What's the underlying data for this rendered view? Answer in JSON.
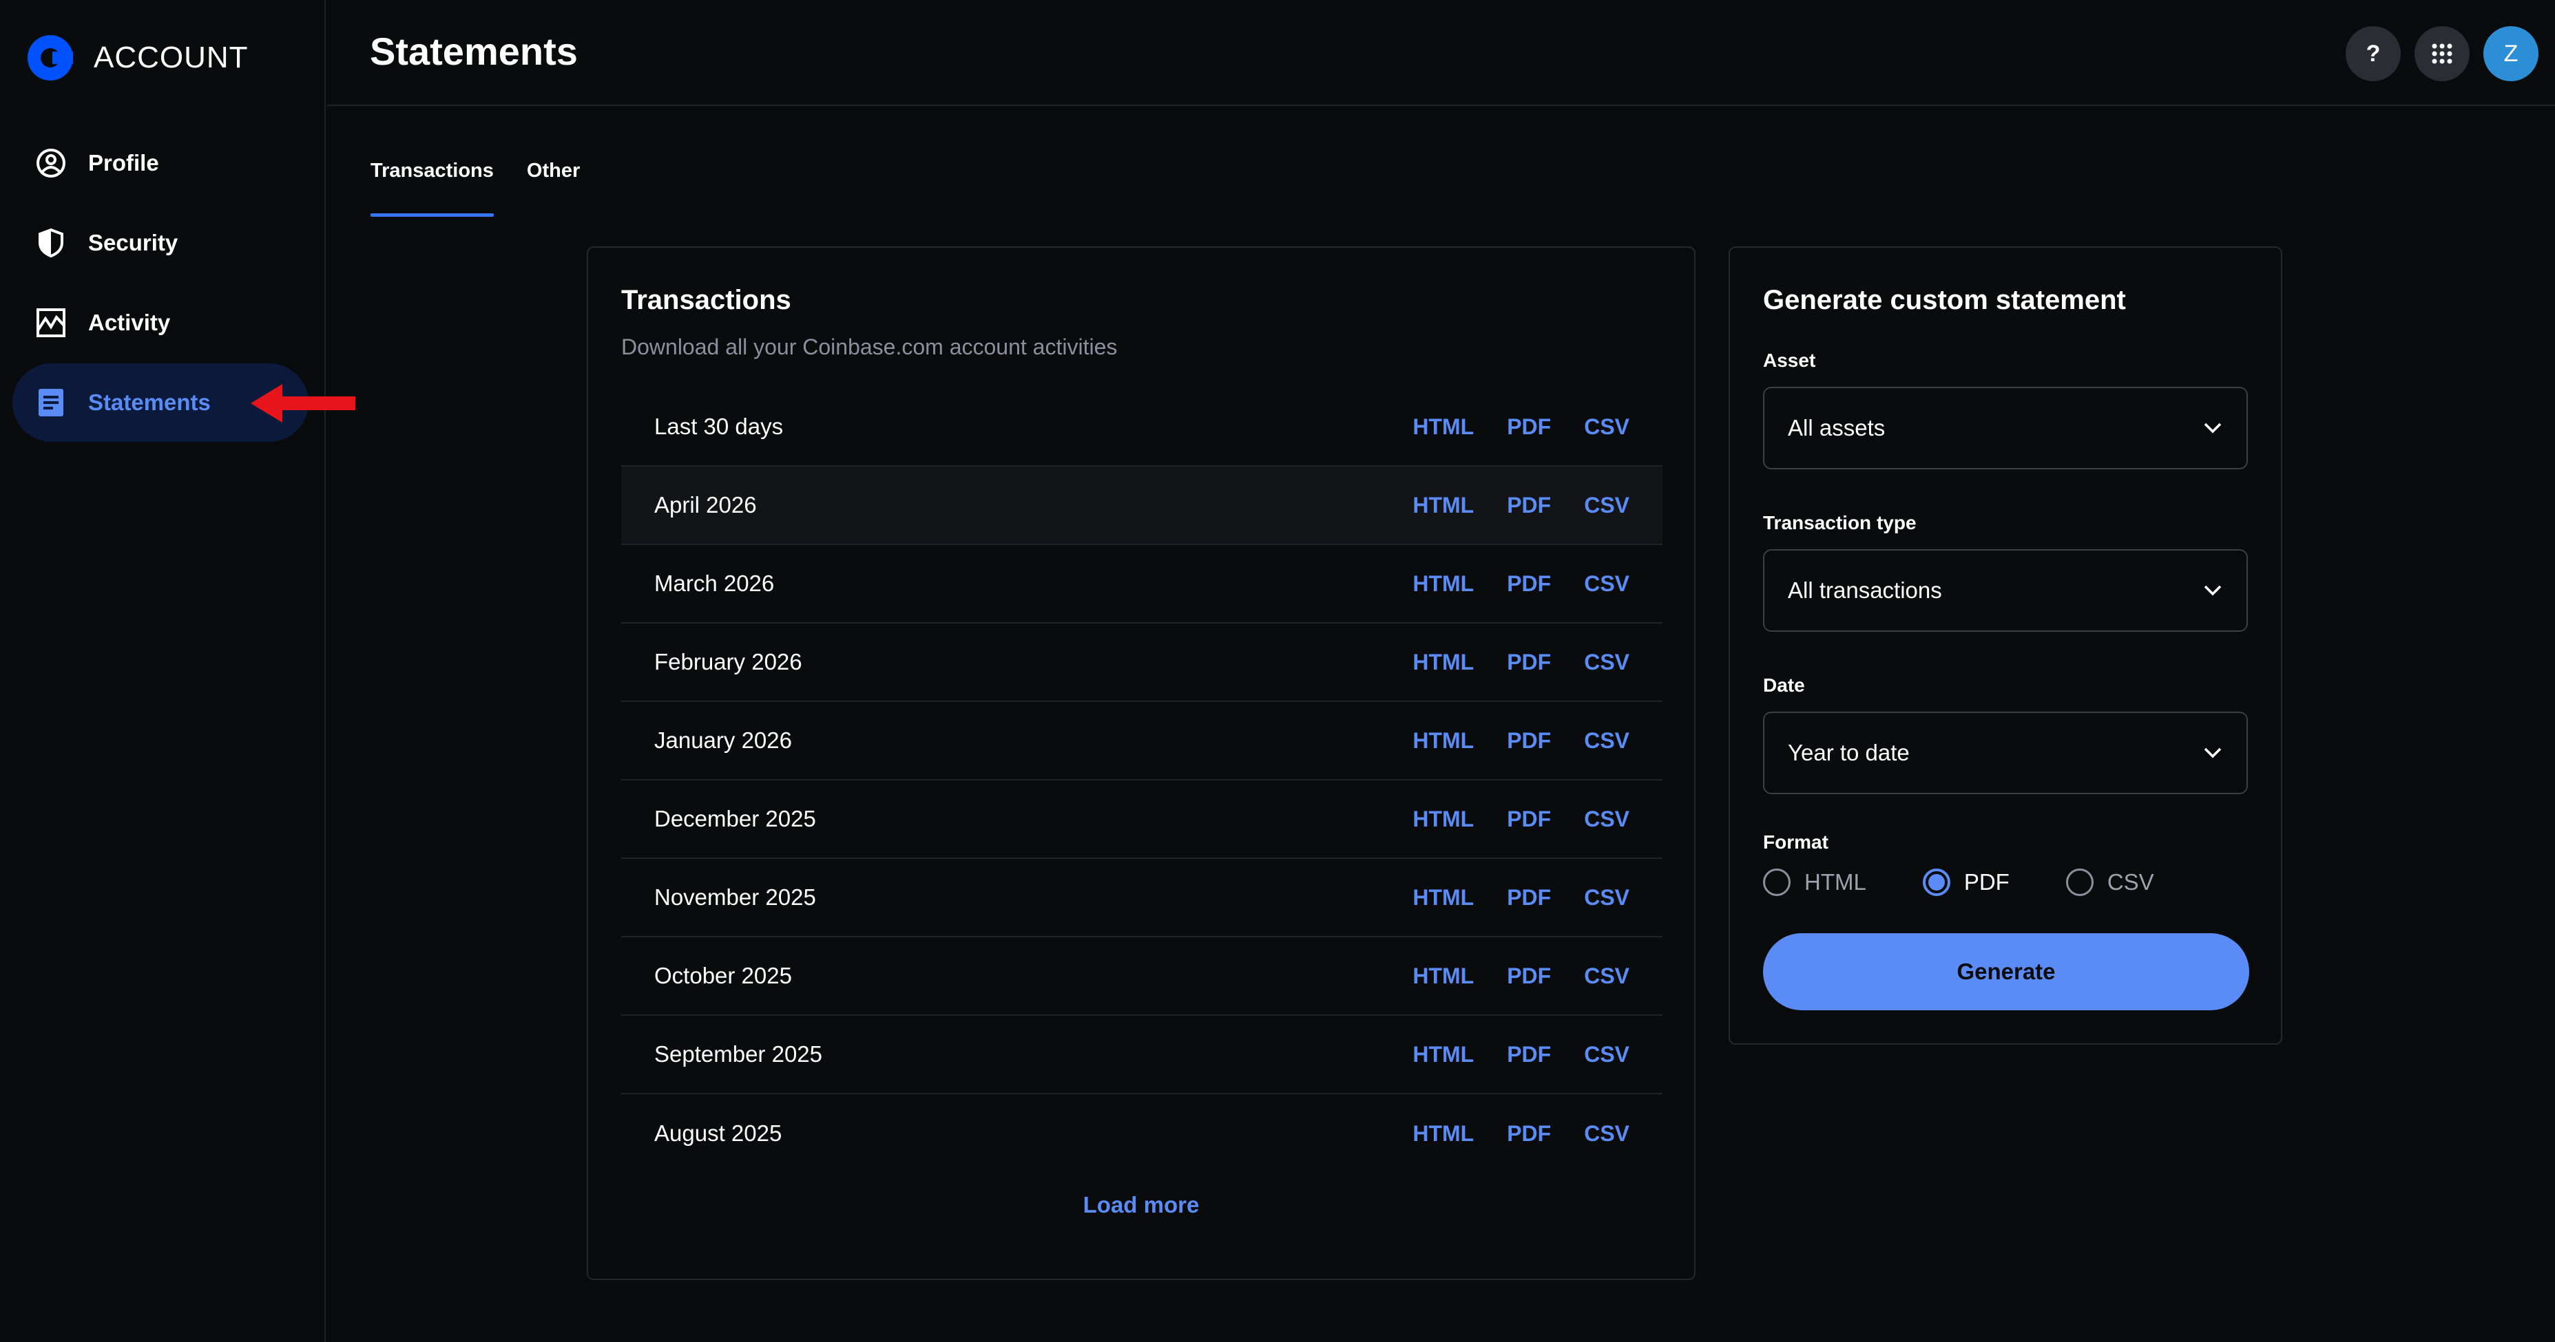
{
  "brand": {
    "label": "ACCOUNT"
  },
  "sidebar": {
    "items": [
      {
        "label": "Profile",
        "icon": "user-circle-icon"
      },
      {
        "label": "Security",
        "icon": "shield-icon"
      },
      {
        "label": "Activity",
        "icon": "activity-chart-icon"
      },
      {
        "label": "Statements",
        "icon": "document-icon",
        "active": true
      }
    ]
  },
  "header": {
    "title": "Statements",
    "help_label": "?",
    "avatar_initial": "Z"
  },
  "tabs": [
    {
      "label": "Transactions",
      "active": true
    },
    {
      "label": "Other",
      "active": false
    }
  ],
  "transactions": {
    "title": "Transactions",
    "subtitle": "Download all your Coinbase.com account activities",
    "link_labels": {
      "html": "HTML",
      "pdf": "PDF",
      "csv": "CSV"
    },
    "rows": [
      {
        "period": "Last 30 days"
      },
      {
        "period": "April 2026"
      },
      {
        "period": "March 2026"
      },
      {
        "period": "February 2026"
      },
      {
        "period": "January 2026"
      },
      {
        "period": "December 2025"
      },
      {
        "period": "November 2025"
      },
      {
        "period": "October 2025"
      },
      {
        "period": "September 2025"
      },
      {
        "period": "August 2025"
      }
    ],
    "load_more": "Load more"
  },
  "generate": {
    "title": "Generate custom statement",
    "asset": {
      "label": "Asset",
      "value": "All assets"
    },
    "transaction_type": {
      "label": "Transaction type",
      "value": "All transactions"
    },
    "date": {
      "label": "Date",
      "value": "Year to date"
    },
    "format": {
      "label": "Format",
      "options": [
        "HTML",
        "PDF",
        "CSV"
      ],
      "selected": "PDF"
    },
    "button": "Generate"
  },
  "colors": {
    "accent": "#5b8cf5",
    "brand_blue": "#0052ff",
    "annotation_arrow": "#e8141c",
    "background": "#0a0b0d"
  }
}
